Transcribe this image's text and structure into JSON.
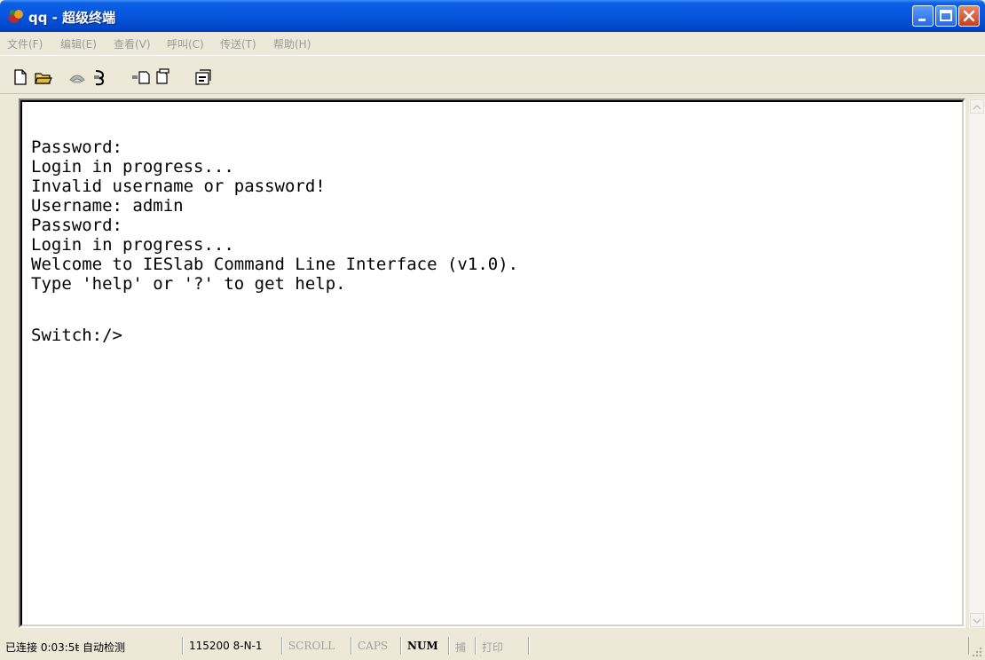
{
  "window": {
    "title": "qq - 超级终端",
    "title_bar_color": "#0a5fe4"
  },
  "menu": [
    {
      "label": "文件(F)"
    },
    {
      "label": "编辑(E)"
    },
    {
      "label": "查看(V)"
    },
    {
      "label": "呼叫(C)"
    },
    {
      "label": "传送(T)"
    },
    {
      "label": "帮助(H)"
    }
  ],
  "toolbar": {
    "icons": [
      "new-file-icon",
      "open-folder-icon",
      "connect-phone-icon",
      "disconnect-phone-icon",
      "send-file-icon",
      "receive-file-icon",
      "properties-icon"
    ]
  },
  "terminal": {
    "lines": [
      "Password:",
      "Login in progress...",
      "Invalid username or password!",
      "Username: admin",
      "Password:",
      "Login in progress...",
      "Welcome to IESlab Command Line Interface (v1.0).",
      "Type 'help' or '?' to get help.",
      "",
      "Switch:/>"
    ]
  },
  "status": {
    "connected": "已连接 0:03:5ŧ 自动检测",
    "baud": "115200 8-N-1",
    "scroll": "SCROLL",
    "caps": "CAPS",
    "num": "NUM",
    "capture": "捕",
    "print": "打印"
  }
}
